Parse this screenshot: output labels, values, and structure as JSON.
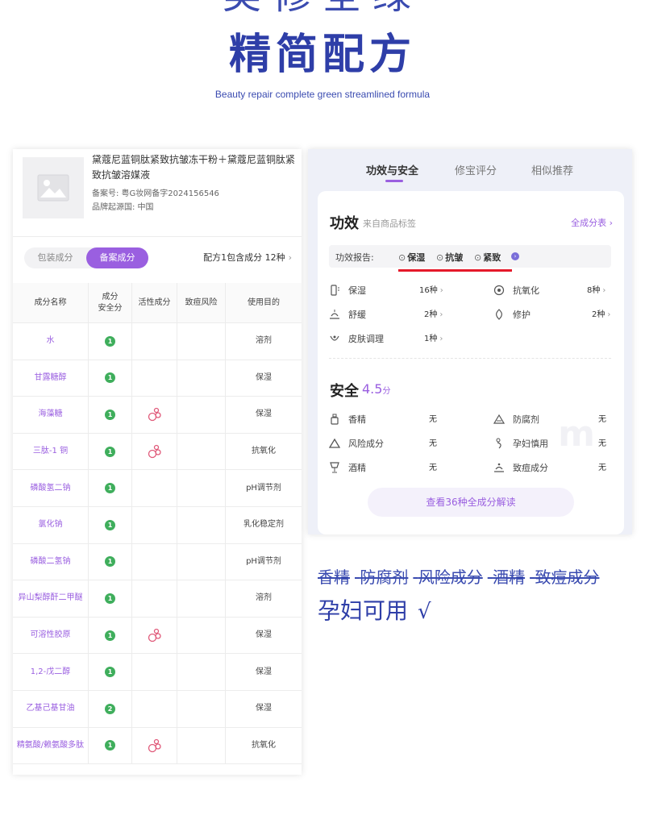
{
  "hero": {
    "top_text": "美修全绿",
    "title": "精简配方",
    "subtitle": "Beauty repair complete green streamlined formula"
  },
  "product": {
    "name": "黛蔻尼蓝铜肽紧致抗皱冻干粉＋黛蔻尼蓝铜肽紧致抗皱溶媒液",
    "registration": "备案号: 粤G妆网备字2024156546",
    "origin": "品牌起源国: 中国",
    "image_icon": "image-placeholder-icon"
  },
  "segment": {
    "items": [
      "包装成分",
      "备案成分"
    ],
    "active_index": 1,
    "formula_info": "配方1包含成分 12种",
    "chevron": "›"
  },
  "table": {
    "headers": [
      "成分名称",
      "成分\n安全分",
      "活性成分",
      "致痘风险",
      "使用目的"
    ],
    "rows": [
      {
        "name": "水",
        "score": "1",
        "active": false,
        "acne": "",
        "purpose": "溶剂"
      },
      {
        "name": "甘露糖醇",
        "score": "1",
        "active": false,
        "acne": "",
        "purpose": "保湿"
      },
      {
        "name": "海藻糖",
        "score": "1",
        "active": true,
        "acne": "",
        "purpose": "保湿"
      },
      {
        "name": "三肽-1 铜",
        "score": "1",
        "active": true,
        "acne": "",
        "purpose": "抗氧化"
      },
      {
        "name": "磷酸氢二钠",
        "score": "1",
        "active": false,
        "acne": "",
        "purpose": "pH调节剂"
      },
      {
        "name": "氯化钠",
        "score": "1",
        "active": false,
        "acne": "",
        "purpose": "乳化稳定剂"
      },
      {
        "name": "磷酸二氢钠",
        "score": "1",
        "active": false,
        "acne": "",
        "purpose": "pH调节剂"
      },
      {
        "name": "异山梨醇酐二甲醚",
        "score": "1",
        "active": false,
        "acne": "",
        "purpose": "溶剂"
      },
      {
        "name": "可溶性胶原",
        "score": "1",
        "active": true,
        "acne": "",
        "purpose": "保湿"
      },
      {
        "name": "1,2-戊二醇",
        "score": "1",
        "active": false,
        "acne": "",
        "purpose": "保湿"
      },
      {
        "name": "乙基己基甘油",
        "score": "2",
        "active": false,
        "acne": "",
        "purpose": "保湿"
      },
      {
        "name": "精氨酸/赖氨酸多肽",
        "score": "1",
        "active": true,
        "acne": "",
        "purpose": "抗氧化"
      }
    ]
  },
  "right": {
    "tabs": [
      "功效与安全",
      "修宝评分",
      "相似推荐"
    ],
    "active_tab": 0,
    "efficacy": {
      "title": "功效",
      "note": "来自商品标签",
      "all_link": "全成分表 ›",
      "report_label": "功效报告:",
      "report_items": [
        "保湿",
        "抗皱",
        "紧致"
      ],
      "report_check": "⊙",
      "report_more": "›",
      "items": [
        {
          "label": "保湿",
          "count": "16种",
          "icon": "moisture-icon"
        },
        {
          "label": "抗氧化",
          "count": "8种",
          "icon": "antioxidant-icon"
        },
        {
          "label": "舒缓",
          "count": "2种",
          "icon": "soothe-icon"
        },
        {
          "label": "修护",
          "count": "2种",
          "icon": "repair-icon"
        },
        {
          "label": "皮肤调理",
          "count": "1种",
          "icon": "skin-care-icon"
        }
      ],
      "chevron": "›"
    },
    "safety": {
      "title": "安全",
      "score": "4.5",
      "score_unit": "分",
      "items": [
        {
          "label": "香精",
          "value": "无",
          "icon": "fragrance-icon"
        },
        {
          "label": "防腐剂",
          "value": "无",
          "icon": "preservative-icon"
        },
        {
          "label": "风险成分",
          "value": "无",
          "icon": "risk-icon"
        },
        {
          "label": "孕妇慎用",
          "value": "无",
          "icon": "pregnancy-icon"
        },
        {
          "label": "酒精",
          "value": "无",
          "icon": "alcohol-icon"
        },
        {
          "label": "致痘成分",
          "value": "无",
          "icon": "acne-icon"
        }
      ]
    },
    "view_all": "查看36种全成分解读",
    "watermark": "m"
  },
  "annotation": {
    "struck": [
      "香精",
      "防腐剂",
      "风险成分",
      "酒精",
      "致痘成分"
    ],
    "pregnancy_ok": "孕妇可用",
    "tick": "√"
  },
  "colors": {
    "accent": "#9a5fe0",
    "brand_blue": "#2e3ea8",
    "badge_green": "#3fae5c",
    "active_pink": "#e05a7a",
    "strike_red": "#e5192a"
  }
}
